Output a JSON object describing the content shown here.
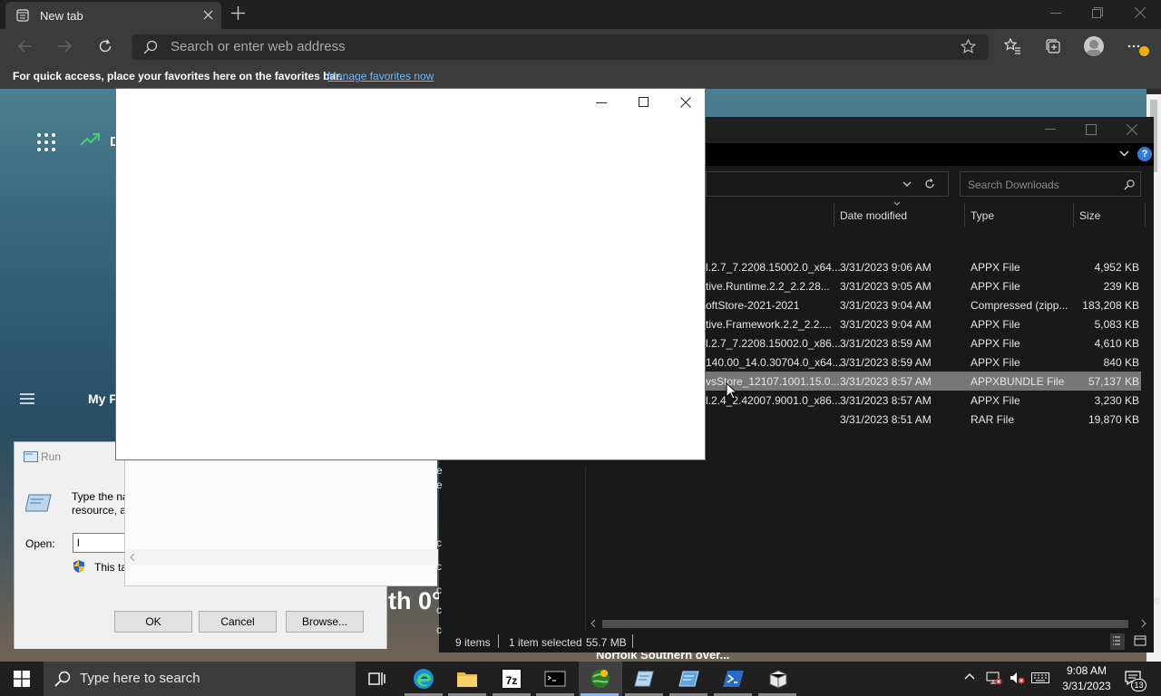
{
  "browser": {
    "tab_title": "New tab",
    "address_placeholder": "Search or enter web address",
    "favbar_text": "For quick access, place your favorites here on the favorites bar.",
    "favbar_link": "Manage favorites now"
  },
  "newtab": {
    "partial_d": "D",
    "my_feed_partial": "My F",
    "weather_partial": "th 0°",
    "news_partial": "Norfolk Southern over..."
  },
  "explorer": {
    "search_placeholder": "Search Downloads",
    "columns": {
      "date": "Date modified",
      "type": "Type",
      "size": "Size"
    },
    "rows": [
      {
        "name": "l.2.7_7.2208.15002.0_x64...",
        "date": "3/31/2023 9:06 AM",
        "type": "APPX File",
        "size": "4,952 KB"
      },
      {
        "name": "tive.Runtime.2.2_2.2.28...",
        "date": "3/31/2023 9:05 AM",
        "type": "APPX File",
        "size": "239 KB"
      },
      {
        "name": "oftStore-2021-2021",
        "date": "3/31/2023 9:04 AM",
        "type": "Compressed (zipp...",
        "size": "183,208 KB"
      },
      {
        "name": "tive.Framework.2.2_2.2....",
        "date": "3/31/2023 9:04 AM",
        "type": "APPX File",
        "size": "5,083 KB"
      },
      {
        "name": "l.2.7_7.2208.15002.0_x86...",
        "date": "3/31/2023 8:59 AM",
        "type": "APPX File",
        "size": "4,610 KB"
      },
      {
        "name": "140.00_14.0.30704.0_x64...",
        "date": "3/31/2023 8:59 AM",
        "type": "APPX File",
        "size": "840 KB"
      },
      {
        "name": "vsStore_12107.1001.15.0...",
        "date": "3/31/2023 8:57 AM",
        "type": "APPXBUNDLE File",
        "size": "57,137 KB"
      },
      {
        "name": "l.2.4_2.42007.9001.0_x86...",
        "date": "3/31/2023 8:57 AM",
        "type": "APPX File",
        "size": "3,230 KB"
      },
      {
        "name": "",
        "date": "3/31/2023 8:51 AM",
        "type": "RAR File",
        "size": "19,870 KB"
      }
    ],
    "status": {
      "items": "9 items",
      "selected": "1 item selected",
      "size": "55.7 MB"
    },
    "left_letters": [
      "e",
      "e",
      "c",
      "c",
      "c",
      "c",
      "c"
    ],
    "right_letter": "e"
  },
  "run": {
    "title": "Run",
    "desc_line1": "Type the na",
    "desc_line2": "resource, a",
    "open_label": "Open:",
    "open_value": "l",
    "admin_text": "This ta",
    "ok": "OK",
    "cancel": "Cancel",
    "browse": "Browse..."
  },
  "taskbar": {
    "search_placeholder": "Type here to search",
    "time": "9:08 AM",
    "date": "3/31/2023",
    "notif_count": "13",
    "zip_label": "7z"
  }
}
